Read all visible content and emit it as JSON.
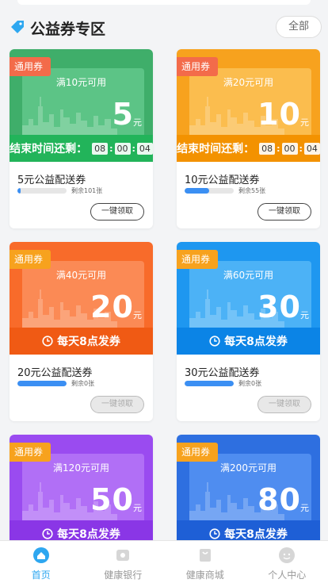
{
  "header": {
    "title": "公益券专区",
    "all_label": "全部"
  },
  "coupons": [
    {
      "badge": "通用券",
      "min": "满10元可用",
      "amount": "5",
      "unit": "元",
      "mode": "timer",
      "timer_label": "结束时间还剩：",
      "timer": [
        "08",
        "00",
        "04"
      ],
      "name": "5元公益配送券",
      "remaining": "剩余101张",
      "progress": 0.06,
      "button": "一键领取",
      "button_enabled": true,
      "color": "#3fae6a",
      "inner": "#5cc486",
      "badge_color": "#f36b4a",
      "bottom_color": "#22b45a"
    },
    {
      "badge": "通用券",
      "min": "满20元可用",
      "amount": "10",
      "unit": "元",
      "mode": "timer",
      "timer_label": "结束时间还剩：",
      "timer": [
        "08",
        "00",
        "04"
      ],
      "name": "10元公益配送券",
      "remaining": "剩余55张",
      "progress": 0.5,
      "button": "一键领取",
      "button_enabled": true,
      "color": "#f7a21e",
      "inner": "#fbbd4e",
      "badge_color": "#f36b4a",
      "bottom_color": "#f39200"
    },
    {
      "badge": "通用券",
      "min": "满40元可用",
      "amount": "20",
      "unit": "元",
      "mode": "daily",
      "daily_label": "每天8点发券",
      "name": "20元公益配送券",
      "remaining": "剩余0张",
      "progress": 1.0,
      "button": "一键领取",
      "button_enabled": false,
      "color": "#f86b2a",
      "inner": "#fb8a55",
      "badge_color": "#f7a21e",
      "bottom_color": "#f05a14"
    },
    {
      "badge": "通用券",
      "min": "满60元可用",
      "amount": "30",
      "unit": "元",
      "mode": "daily",
      "daily_label": "每天8点发券",
      "name": "30元公益配送券",
      "remaining": "剩余0张",
      "progress": 1.0,
      "button": "一键领取",
      "button_enabled": false,
      "color": "#1e97f0",
      "inner": "#4cb2f6",
      "badge_color": "#f7a21e",
      "bottom_color": "#0b84e6"
    },
    {
      "badge": "通用券",
      "min": "满120元可用",
      "amount": "50",
      "unit": "元",
      "mode": "daily",
      "daily_label": "每天8点发券",
      "name": "",
      "remaining": "",
      "progress": null,
      "button": "",
      "button_enabled": null,
      "color": "#9a4bf0",
      "inner": "#b16ff6",
      "badge_color": "#f7a21e",
      "bottom_color": "#8a36e6"
    },
    {
      "badge": "通用券",
      "min": "满200元可用",
      "amount": "80",
      "unit": "元",
      "mode": "daily",
      "daily_label": "每天8点发券",
      "name": "",
      "remaining": "",
      "progress": null,
      "button": "",
      "button_enabled": null,
      "color": "#2e6fe0",
      "inner": "#4f8df0",
      "badge_color": "#f7a21e",
      "bottom_color": "#1e5fd6"
    }
  ],
  "tabbar": [
    {
      "label": "首页",
      "icon": "home-icon",
      "active": true
    },
    {
      "label": "健康银行",
      "icon": "bank-icon",
      "active": false
    },
    {
      "label": "健康商城",
      "icon": "shop-icon",
      "active": false
    },
    {
      "label": "个人中心",
      "icon": "user-icon",
      "active": false
    }
  ],
  "colors": {
    "accent": "#2ea7f0",
    "progress": "#3b8ff3"
  }
}
